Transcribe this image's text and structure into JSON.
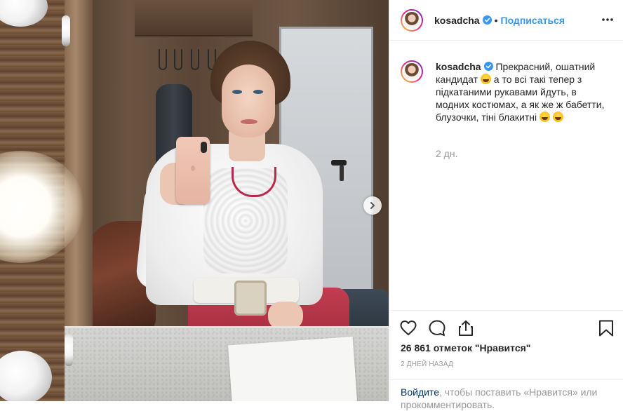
{
  "post": {
    "username": "kosadcha",
    "dot": "•",
    "follow_label": "Подписаться",
    "caption": {
      "username": "kosadcha",
      "part1": "Прекрасний, ошатний кандидат",
      "part2": "а то всі такі тепер з підкатаними рукавами йдуть, в модних костюмах, а як же ж бабетти, блузочки, тіні блакитні"
    },
    "time_ago": "2 дн.",
    "likes": "26 861 отметок \"Нравится\"",
    "date": "2 ДНЕЙ НАЗАД",
    "login_prompt": {
      "link": "Войдите",
      "rest": ", чтобы поставить «Нравится» или прокомментировать."
    }
  },
  "icons": {
    "verified": "verified-badge-icon",
    "more": "more-options-icon",
    "like": "heart-icon",
    "comment": "comment-icon",
    "share": "share-icon",
    "save": "bookmark-icon",
    "next": "chevron-right-icon",
    "emoji": "grinning-sweat-emoji"
  },
  "colors": {
    "accent": "#3897f0",
    "text": "#262626",
    "muted": "#999999",
    "link": "#003569",
    "verified": "#3897f0"
  }
}
